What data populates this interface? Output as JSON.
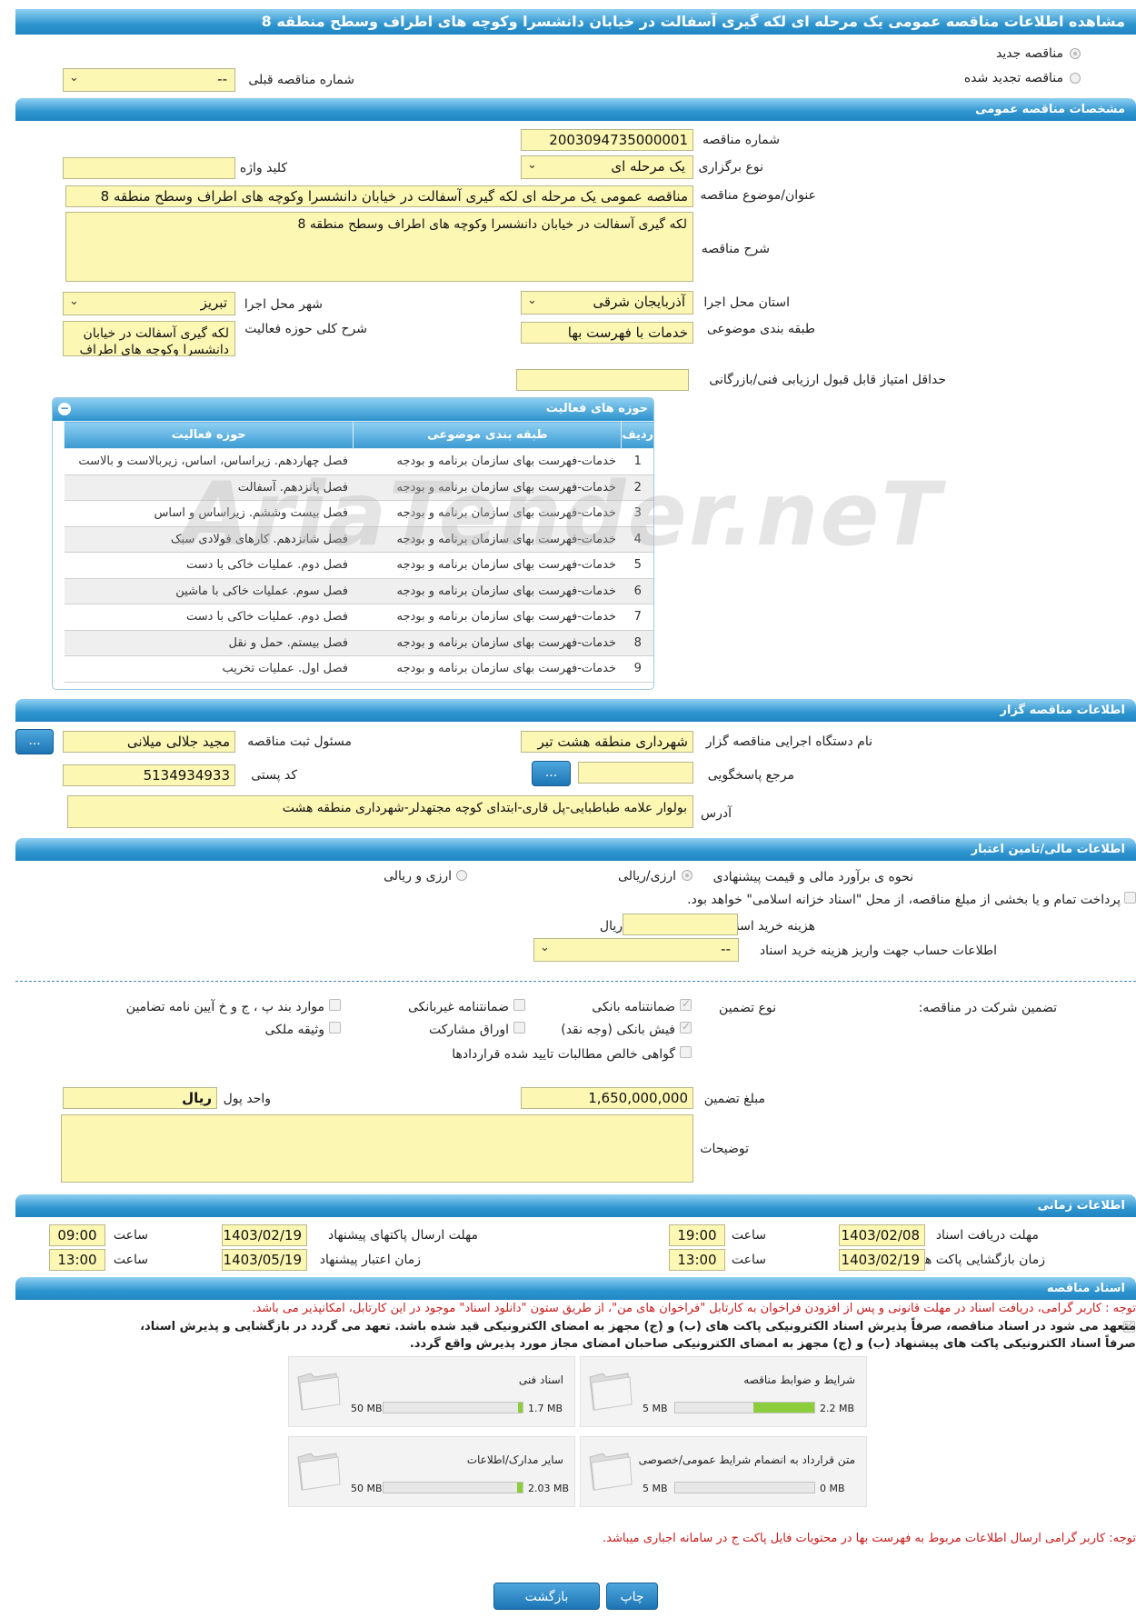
{
  "title": "مشاهده اطلاعات مناقصه عمومی یک مرحله ای لکه گیری آسفالت در خیابان دانشسرا وکوچه های اطراف وسطح منطقه 8",
  "tender_type": {
    "new_label": "مناقصه جدید",
    "renewed_label": "مناقصه تجدید شده",
    "prev_label": "شماره مناقصه قبلی",
    "prev_value": "--"
  },
  "general": {
    "header": "مشخصات مناقصه عمومی",
    "number_label": "شماره مناقصه",
    "number": "2003094735000001",
    "holding_label": "نوع برگزاری",
    "holding": "یک مرحله ای",
    "keyword_label": "کلید واژه",
    "keyword": "",
    "subject_label": "عنوان/موضوع مناقصه",
    "subject": "مناقصه عمومی یک مرحله ای لکه گیری آسفالت در خیابان دانشسرا وکوچه های اطراف وسطح منطقه 8",
    "desc_label": "شرح مناقصه",
    "desc": "لکه گیری آسفالت در خیابان دانشسرا وکوچه های اطراف وسطح منطقه 8",
    "province_label": "استان محل اجرا",
    "province": "آذربایجان شرقی",
    "city_label": "شهر محل اجرا",
    "city": "تبریز",
    "category_label": "طبقه بندی موضوعی",
    "category": "خدمات با فهرست بها",
    "scope_label": "شرح کلی حوزه فعالیت",
    "scope": "لکه گیری آسفالت در خیابان دانشسرا وکوچه های اطراف",
    "min_score_label": "حداقل امتیاز قابل قبول ارزیابی فنی/بازرگانی",
    "min_score": ""
  },
  "activities": {
    "header": "حوزه های فعالیت",
    "columns": [
      "ردیف",
      "طبقه بندی موضوعی",
      "حوزه فعالیت"
    ],
    "rows": [
      [
        "1",
        "خدمات-فهرست بهای سازمان برنامه و بودجه",
        "فصل چهاردهم. زیراساس، اساس، زیربالاست  و بالاست"
      ],
      [
        "2",
        "خدمات-فهرست بهای سازمان برنامه و بودجه",
        "فصل پانزدهم. آسفالت"
      ],
      [
        "3",
        "خدمات-فهرست بهای سازمان برنامه و بودجه",
        "فصل بیست وششم. زیراساس و اساس"
      ],
      [
        "4",
        "خدمات-فهرست بهای سازمان برنامه و بودجه",
        "فصل شانزدهم. کارهای فولادی سبک"
      ],
      [
        "5",
        "خدمات-فهرست بهای سازمان برنامه و بودجه",
        "فصل دوم. عملیات خاکی با دست"
      ],
      [
        "6",
        "خدمات-فهرست بهای سازمان برنامه و بودجه",
        "فصل سوم. عملیات خاکی با ماشین"
      ],
      [
        "7",
        "خدمات-فهرست بهای سازمان برنامه و بودجه",
        "فصل دوم. عملیات خاکی با دست"
      ],
      [
        "8",
        "خدمات-فهرست بهای سازمان برنامه و بودجه",
        "فصل بیستم. حمل و نقل"
      ],
      [
        "9",
        "خدمات-فهرست بهای سازمان برنامه و بودجه",
        "فصل اول. عملیات تخریب"
      ]
    ]
  },
  "organizer": {
    "header": "اطلاعات مناقصه گزار",
    "org_label": "نام دستگاه اجرایی مناقصه گزار",
    "org": "شهرداری منطقه هشت تبر",
    "responsible_label": "مسئول ثبت مناقصه",
    "responsible": "مجید جلالی میلانی",
    "reference_label": "مرجع پاسخگویی",
    "reference": "",
    "postal_label": "کد پستی",
    "postal": "5134934933",
    "address_label": "آدرس",
    "address": "بولوار علامه طباطبایی-پل قاری-ابتدای کوچه مجتهدلر-شهرداری منطقه هشت",
    "more_btn": "..."
  },
  "financial": {
    "header": "اطلاعات مالی/تامین اعتبار",
    "estimate_label": "نحوه ی برآورد مالی و قیمت پیشنهادی",
    "opt1": "ارزی/ریالی",
    "opt2": "ارزی و ریالی",
    "treasury_text": "پرداخت تمام و یا بخشی از مبلغ مناقصه، از محل \"اسناد خزانه اسلامی\" خواهد بود.",
    "doc_cost_label": "هزینه خرید اسناد",
    "doc_cost": "",
    "doc_cost_unit": "ریال",
    "account_label": "اطلاعات حساب جهت واریز هزینه خرید اسناد",
    "account": "--"
  },
  "guarantee": {
    "label": "تضمین شرکت در مناقصه:",
    "type_label": "نوع تضمین",
    "options": {
      "bank_guarantee": "ضمانتنامه بانکی",
      "nonbank_guarantee": "ضمانتنامه غیربانکی",
      "regulation_items": "موارد بند پ ، ج و خ آیین نامه تضامین",
      "bank_receipt": "فیش بانکی (وجه نقد)",
      "bonds": "اوراق مشارکت",
      "property": "وثیقه ملکی",
      "claims_cert": "گواهی خالص مطالبات تایید شده قراردادها"
    },
    "amount_label": "مبلغ تضمین",
    "amount": "1,650,000,000",
    "currency_label": "واحد پول",
    "currency": "ریال",
    "notes_label": "توضیحات",
    "notes": ""
  },
  "timing": {
    "header": "اطلاعات زمانی",
    "receive_label": "مهلت دریافت اسناد",
    "receive_date": "1403/02/08",
    "receive_time": "19:00",
    "send_label": "مهلت ارسال پاکتهای پیشنهاد",
    "send_date": "1403/02/19",
    "send_time": "09:00",
    "open_label": "زمان بازگشایی پاکت ها",
    "open_date": "1403/02/19",
    "open_time": "13:00",
    "validity_label": "زمان اعتبار پیشنهاد",
    "validity_date": "1403/05/19",
    "validity_time": "13:00",
    "time_label": "ساعت"
  },
  "documents": {
    "header": "اسناد مناقصه",
    "note": "توجه : کاربر گرامی، دریافت اسناد در مهلت قانونی و پس از افزودن فراخوان به کارتابل \"فراخوان های من\"، از طریق ستون \"دانلود اسناد\" موجود در این کارتابل، امکانپذیر می باشد.",
    "commit_line1": "متعهد می شود در اسناد مناقصه، صرفاً پذیرش اسناد الکترونیکی پاکت های (ب) و (ج) مجهز به امضای الکترونیکی قید شده باشد. تعهد می گردد در بازگشایی و پذیرش اسناد،",
    "commit_line2": "صرفاً اسناد الکترونیکی پاکت های پیشنهاد (ب) و (ج) مجهز به امضای الکترونیکی صاحبان امضای مجاز مورد پذیرش واقع گردد.",
    "cards": [
      {
        "name": "شرایط و ضوابط مناقصه",
        "used": "2.2 MB",
        "max": "5 MB",
        "fraction": 0.44
      },
      {
        "name": "اسناد فنی",
        "used": "1.7 MB",
        "max": "50 MB",
        "fraction": 0.034
      },
      {
        "name": "متن قرارداد به انضمام شرایط عمومی/خصوصی",
        "used": "0 MB",
        "max": "5 MB",
        "fraction": 0.0
      },
      {
        "name": "سایر مدارک/اطلاعات",
        "used": "2.03 MB",
        "max": "50 MB",
        "fraction": 0.041
      }
    ],
    "footer_note": "توجه: کاربر گرامی ارسال اطلاعات مربوط به فهرست بها در محتویات فایل پاکت ج در سامانه اجباری میباشد."
  },
  "actions": {
    "print": "چاپ",
    "back": "بازگشت"
  },
  "watermark": "AriaTender.neT",
  "colors": {
    "header": "#2f95cf",
    "input": "#fdf7b4",
    "progress": "#8ccd3c",
    "note": "#c61a1a"
  }
}
